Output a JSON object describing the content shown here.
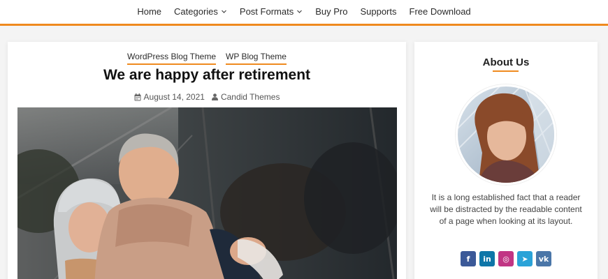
{
  "nav": {
    "items": [
      {
        "label": "Home",
        "dropdown": false
      },
      {
        "label": "Categories",
        "dropdown": true
      },
      {
        "label": "Post Formats",
        "dropdown": true
      },
      {
        "label": "Buy Pro",
        "dropdown": false
      },
      {
        "label": "Supports",
        "dropdown": false
      },
      {
        "label": "Free Download",
        "dropdown": false
      }
    ]
  },
  "post": {
    "categories": [
      "WordPress Blog Theme",
      "WP Blog Theme"
    ],
    "title": "We are happy after retirement",
    "date": "August 14, 2021",
    "author": "Candid Themes",
    "icons": {
      "date": "calendar-icon",
      "author": "user-icon"
    }
  },
  "sidebar": {
    "title": "About Us",
    "text": "It is a long established fact that a reader will be distracted by the readable content of a page when looking at its layout.",
    "socials": [
      {
        "name": "facebook-icon",
        "glyph": "f",
        "color": "#3b5998"
      },
      {
        "name": "linkedin-icon",
        "glyph": "in",
        "color": "#0e76a8"
      },
      {
        "name": "instagram-icon",
        "glyph": "◎",
        "color": "#c13584"
      },
      {
        "name": "telegram-icon",
        "glyph": "➤",
        "color": "#2aa3d8"
      },
      {
        "name": "vk-icon",
        "glyph": "vk",
        "color": "#4a76a8"
      }
    ]
  },
  "colors": {
    "accent": "#ef8a1f"
  }
}
